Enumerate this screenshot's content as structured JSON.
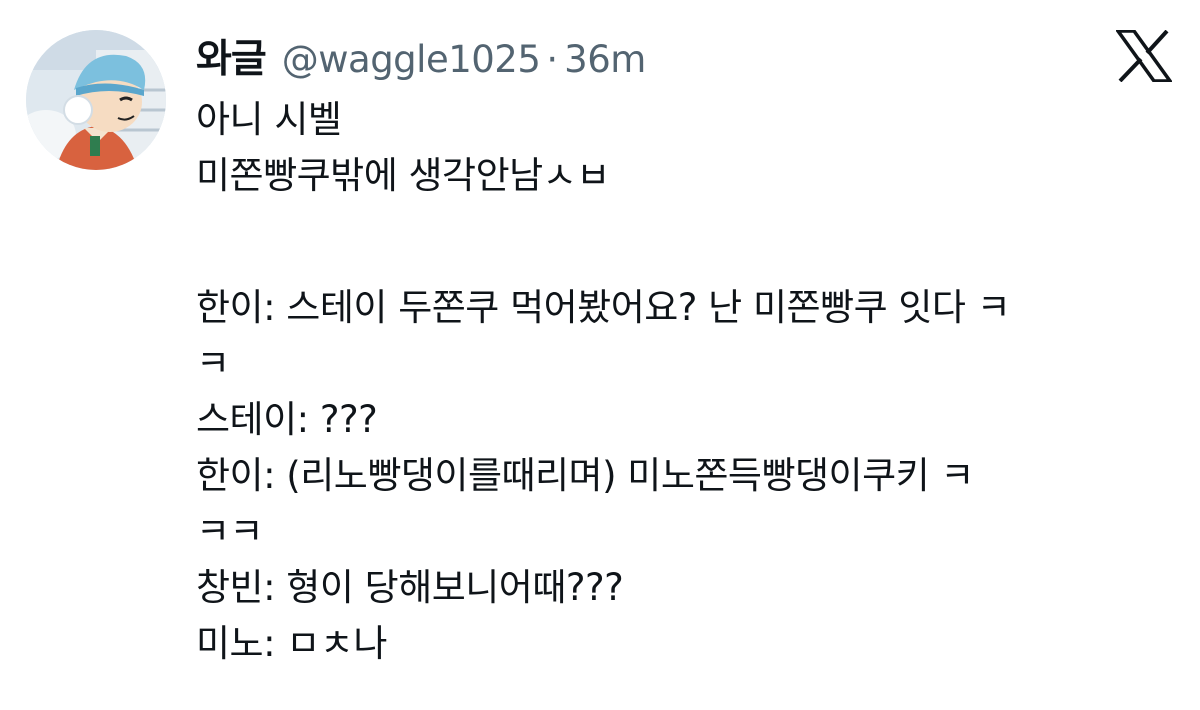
{
  "author": {
    "display_name": "와글",
    "handle": "@waggle1025",
    "separator": "·",
    "time": "36m"
  },
  "logo": {
    "icon": "x-logo-icon"
  },
  "tweet": {
    "lines": [
      "아니 시벨",
      "미쫀빵쿠밖에 생각안남ㅅㅂ",
      "",
      "한이: 스테이 두쫀쿠 먹어봤어요? 난 미쫀빵쿠 잇다 ㅋ",
      "ㅋ",
      "스테이: ???",
      "한이: (리노빵댕이를때리며) 미노쫀득빵댕이쿠키 ㅋ",
      "ㅋㅋ",
      "창빈: 형이 당해보니어때???",
      "미노: ㅁㅊ나"
    ]
  },
  "colors": {
    "text": "#0f1419",
    "secondary": "#536471",
    "background": "#ffffff"
  }
}
